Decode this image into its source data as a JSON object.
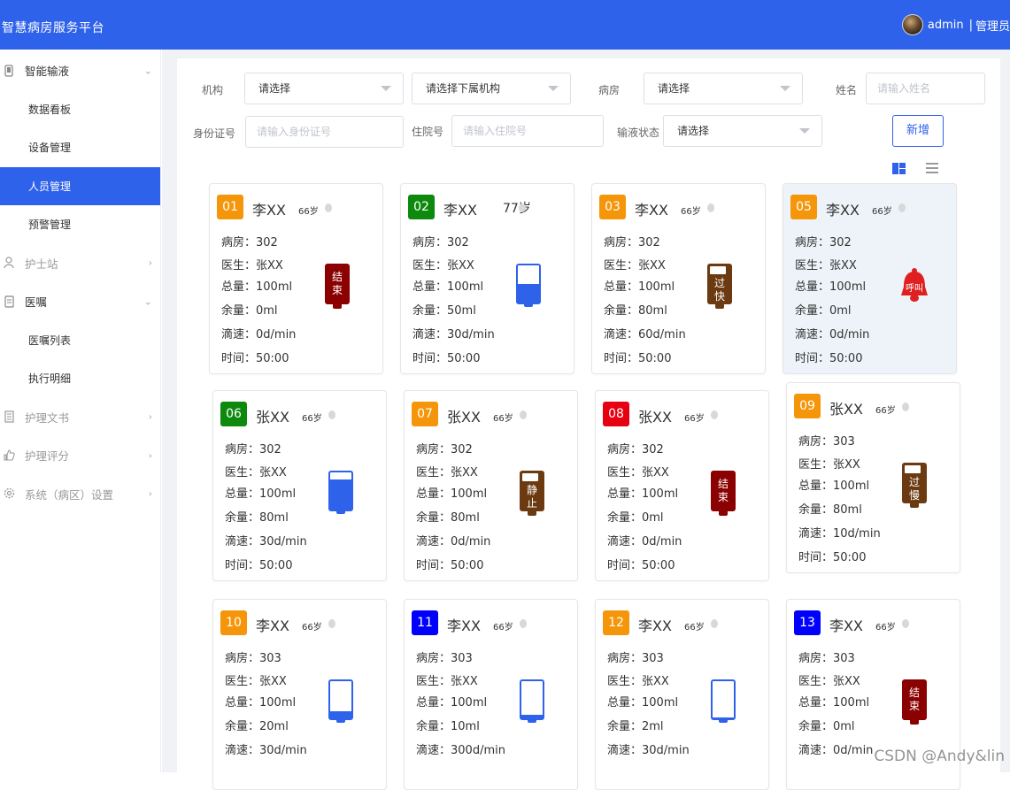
{
  "header": {
    "title": "智慧病房服务平台",
    "username": "admin",
    "separator": "|",
    "role": "管理员"
  },
  "sidebar": {
    "items": [
      {
        "label": "智能输液",
        "icon": "phone-icon",
        "expanded": true
      },
      {
        "label": "数据看板"
      },
      {
        "label": "设备管理"
      },
      {
        "label": "人员管理",
        "active": true
      },
      {
        "label": "预警管理"
      },
      {
        "label": "护士站",
        "icon": "nurse-icon"
      },
      {
        "label": "医嘱",
        "icon": "order-icon",
        "expanded": true
      },
      {
        "label": "医嘱列表"
      },
      {
        "label": "执行明细"
      },
      {
        "label": "护理文书",
        "icon": "document-icon"
      },
      {
        "label": "护理评分",
        "icon": "thumb-up-icon"
      },
      {
        "label": "系统（病区）设置",
        "icon": "settings-icon"
      }
    ]
  },
  "filters": {
    "org_label": "机构",
    "org_value": "请选择",
    "sub_org_value": "请选择下属机构",
    "ward_label": "病房",
    "ward_value": "请选择",
    "name_label": "姓名",
    "name_placeholder": "请输入姓名",
    "id_label": "身份证号",
    "id_placeholder": "请输入身份证号",
    "hosp_label": "住院号",
    "hosp_placeholder": "请输入住院号",
    "status_label": "输液状态",
    "status_value": "请选择",
    "add_button": "新增"
  },
  "colors": {
    "primary": "#2f62ea",
    "orange": "#f5960a",
    "green": "#0d8a0d",
    "red": "#e60012",
    "brown": "#6b3a10",
    "darkred": "#8b0000",
    "bell": "#e02020"
  },
  "cards": [
    {
      "num": "01",
      "numColor": "orange",
      "name": "李XX",
      "age": "66岁",
      "ward": "病房：302",
      "doctor": "医生：张XX",
      "total": "总量：100ml",
      "remain": "余量：0ml",
      "speed": "滴速：0d/min",
      "time": "时间：50:00",
      "status": "red",
      "statusText": "结束"
    },
    {
      "num": "02",
      "numColor": "green",
      "name": "李XX",
      "age": "77岁",
      "ward": "病房：302",
      "doctor": "医生：张XX",
      "total": "总量：100ml",
      "remain": "余量：50ml",
      "speed": "滴速：30d/min",
      "time": "时间：50:00",
      "status": "blue",
      "fill": 0.5
    },
    {
      "num": "03",
      "numColor": "orange",
      "name": "李XX",
      "age": "66岁",
      "ward": "病房：302",
      "doctor": "医生：张XX",
      "total": "总量：100ml",
      "remain": "余量：80ml",
      "speed": "滴速：60d/min",
      "time": "时间：50:00",
      "status": "brown",
      "statusText": "过快"
    },
    {
      "num": "05",
      "numColor": "orange",
      "name": "李XX",
      "age": "66岁",
      "ward": "病房：302",
      "doctor": "医生：张XX",
      "total": "总量：100ml",
      "remain": "余量：0ml",
      "speed": "滴速：0d/min",
      "time": "时间：50:00",
      "status": "bell",
      "statusText": "呼叫"
    },
    {
      "num": "06",
      "numColor": "green",
      "name": "张XX",
      "age": "66岁",
      "ward": "病房：302",
      "doctor": "医生：张XX",
      "total": "总量：100ml",
      "remain": "余量：80ml",
      "speed": "滴速：30d/min",
      "time": "时间：50:00",
      "status": "blue",
      "fill": 0.8
    },
    {
      "num": "07",
      "numColor": "orange",
      "name": "张XX",
      "age": "66岁",
      "ward": "病房：302",
      "doctor": "医生：张XX",
      "total": "总量：100ml",
      "remain": "余量：80ml",
      "speed": "滴速：0d/min",
      "time": "时间：50:00",
      "status": "brown",
      "statusText": "静止"
    },
    {
      "num": "08",
      "numColor": "red",
      "name": "张XX",
      "age": "66岁",
      "ward": "病房：302",
      "doctor": "医生：张XX",
      "total": "总量：100ml",
      "remain": "余量：0ml",
      "speed": "滴速：0d/min",
      "time": "时间：50:00",
      "status": "red",
      "statusText": "结束"
    },
    {
      "num": "09",
      "numColor": "orange",
      "name": "张XX",
      "age": "66岁",
      "ward": "病房：303",
      "doctor": "医生：张XX",
      "total": "总量：100ml",
      "remain": "余量：80ml",
      "speed": "滴速：10d/min",
      "time": "时间：50:00",
      "status": "brown",
      "statusText": "过慢"
    },
    {
      "num": "10",
      "numColor": "orange",
      "name": "李XX",
      "age": "66岁",
      "ward": "病房：303",
      "doctor": "医生：张XX",
      "total": "总量：100ml",
      "remain": "余量：20ml",
      "speed": "滴速：30d/min",
      "time": "",
      "status": "blue",
      "fill": 0.2
    },
    {
      "num": "11",
      "numColor": "blue",
      "name": "李XX",
      "age": "66岁",
      "ward": "病房：303",
      "doctor": "医生：张XX",
      "total": "总量：100ml",
      "remain": "余量：10ml",
      "speed": "滴速：300d/min",
      "time": "",
      "status": "blue",
      "fill": 0.1
    },
    {
      "num": "12",
      "numColor": "orange",
      "name": "李XX",
      "age": "66岁",
      "ward": "病房：303",
      "doctor": "医生：张XX",
      "total": "总量：100ml",
      "remain": "余量：2ml",
      "speed": "滴速：30d/min",
      "time": "",
      "status": "blue",
      "fill": 0.02
    },
    {
      "num": "13",
      "numColor": "blue",
      "name": "李XX",
      "age": "66岁",
      "ward": "病房：303",
      "doctor": "医生：张XX",
      "total": "总量：100ml",
      "remain": "余量：0ml",
      "speed": "滴速：0d/min",
      "time": "",
      "status": "red",
      "statusText": "结束"
    }
  ],
  "watermark": "CSDN @Andy&lin"
}
